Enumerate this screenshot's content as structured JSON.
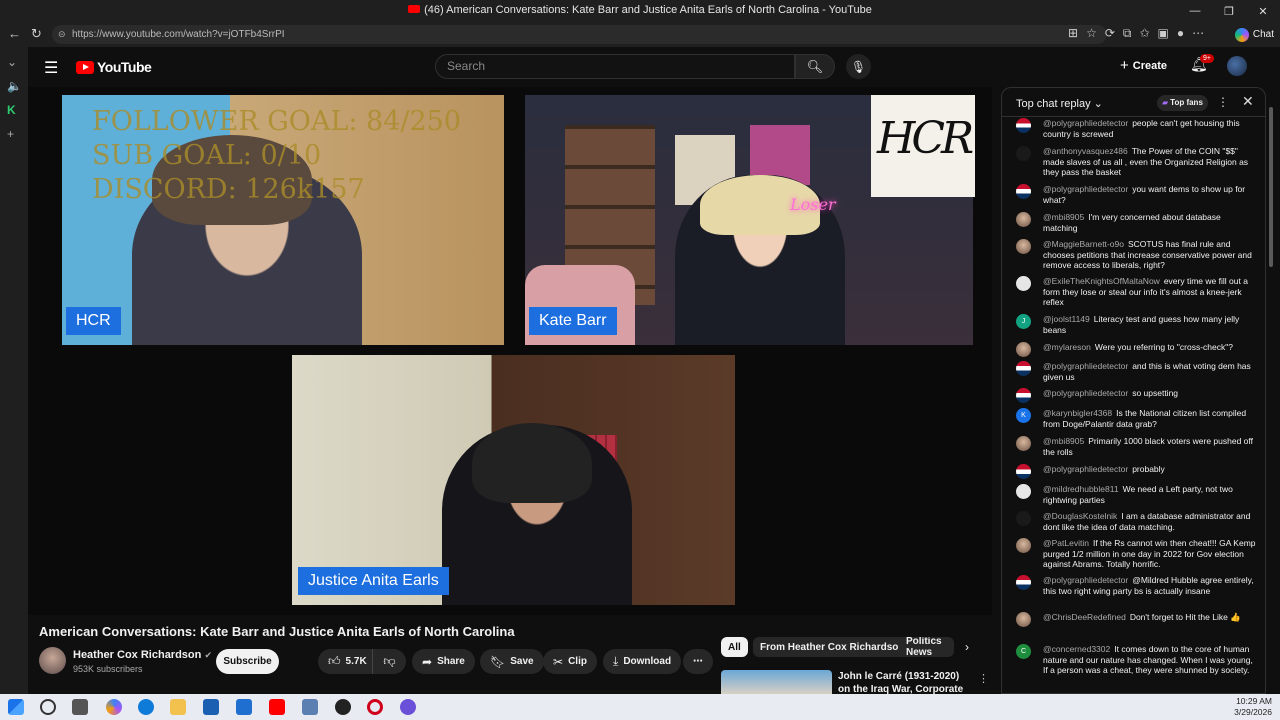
{
  "browser": {
    "tab_title": "(46) American Conversations: Kate Barr and Justice Anita Earls of North Carolina - YouTube",
    "url": "https://www.youtube.com/watch?v=jOTFb4SrrPI",
    "chat_label": "Chat"
  },
  "youtube": {
    "logo_text": "YouTube",
    "search_placeholder": "Search",
    "create_label": "Create",
    "notifications_badge": "9+"
  },
  "video": {
    "overlay_goals": [
      "FOLLOWER GOAL:  84/250",
      "SUB GOAL: 0/10",
      "DISCORD: 126k157"
    ],
    "name_tags": {
      "hcr": "HCR",
      "kate": "Kate Barr",
      "earls": "Justice Anita Earls"
    },
    "logo_text": "HCR",
    "neon_sign": "Loser"
  },
  "info": {
    "title": "American Conversations: Kate Barr and Justice Anita Earls of North Carolina",
    "channel": "Heather Cox Richardson",
    "subscribers": "953K subscribers",
    "subscribe_label": "Subscribe",
    "likes": "5.7K",
    "share_label": "Share",
    "save_label": "Save",
    "clip_label": "Clip",
    "download_label": "Download"
  },
  "chips": [
    "All",
    "From Heather Cox Richardson",
    "Politics News"
  ],
  "recommendation": {
    "title": "John le Carré (1931-2020) on the Iraq War, Corporate Power"
  },
  "chat": {
    "title": "Top chat replay",
    "top_fans_label": "Top fans",
    "messages": [
      {
        "author": "@polygraphliedetector",
        "text": "people can't get housing this country is screwed",
        "avatar": "flag"
      },
      {
        "author": "@anthonyvasquez486",
        "text": "The Power of the COIN \"$$\" made slaves of us all , even the Organized Religion as they pass the basket",
        "avatar": "dark"
      },
      {
        "author": "@polygraphliedetector",
        "text": "you want dems to show up for what?",
        "avatar": "flag"
      },
      {
        "author": "@mbi8905",
        "text": "I'm very concerned about database matching",
        "avatar": "face"
      },
      {
        "author": "@MaggieBarnett-o9o",
        "text": "SCOTUS has final rule and chooses petitions that increase conservative power and remove access to liberals, right?",
        "avatar": "face"
      },
      {
        "author": "@ExileTheKnightsOfMaltaNow",
        "text": "every time we fill out a form they lose or steal our info it's almost a knee-jerk reflex",
        "avatar": "grey"
      },
      {
        "author": "@joolst1149",
        "text": "Literacy test and guess how many jelly beans",
        "avatar": "teal",
        "initial": "J"
      },
      {
        "author": "@mylareson",
        "text": "Were you referring to \"cross-check\"?",
        "avatar": "face"
      },
      {
        "author": "@polygraphliedetector",
        "text": "and this is what voting dem has given us",
        "avatar": "flag"
      },
      {
        "author": "@polygraphliedetector",
        "text": "so upsetting",
        "avatar": "flag"
      },
      {
        "author": "@karynbigler4368",
        "text": "Is the National citizen list compiled from Doge/Palantir data grab?",
        "avatar": "blue",
        "initial": "K"
      },
      {
        "author": "@mbi8905",
        "text": "Primarily 1000 black voters were pushed off the rolls",
        "avatar": "face"
      },
      {
        "author": "@polygraphliedetector",
        "text": "probably",
        "avatar": "flag"
      },
      {
        "author": "@mildredhubble811",
        "text": "We need a Left party, not two rightwing parties",
        "avatar": "grey"
      },
      {
        "author": "@DouglasKostelnik",
        "text": "I am a database administrator and dont like the idea of data matching.",
        "avatar": "dark"
      },
      {
        "author": "@PatLevitin",
        "text": "If the Rs cannot win then cheat!!! GA Kemp purged 1/2 million in one day in 2022 for Gov election against Abrams. Totally horrific.",
        "avatar": "face"
      },
      {
        "author": "@polygraphliedetector",
        "text": "@Mildred Hubble agree entirely, this two right wing party bs is actually insane",
        "avatar": "flag"
      },
      {
        "author": "@ChrisDeeRedefined",
        "text": "Don't forget to Hit the Like 👍",
        "avatar": "face"
      },
      {
        "author": "@concerned3302",
        "text": "It comes down to the core of human nature and our nature has changed. When I was young, If a person was a cheat, they were shunned by society.",
        "avatar": "green",
        "initial": "C"
      }
    ]
  },
  "taskbar": {
    "time": "10:29 AM",
    "date": "3/29/2026"
  }
}
